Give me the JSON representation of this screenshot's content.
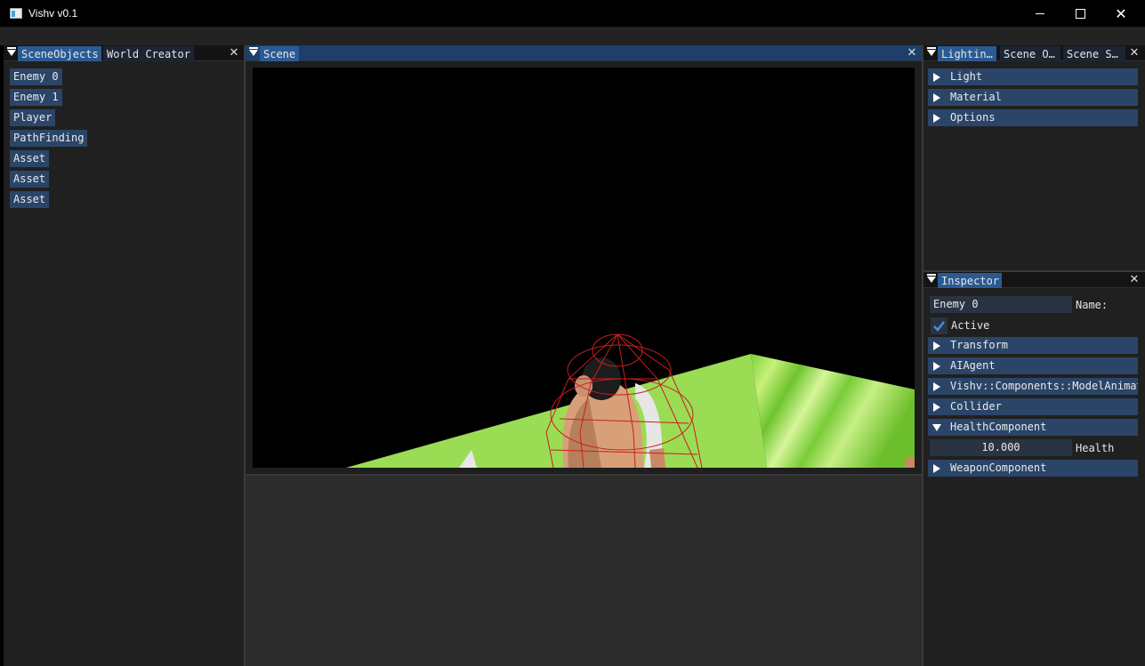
{
  "window": {
    "title": "Vishv v0.1",
    "minimize_icon": "minimize-icon",
    "maximize_icon": "maximize-icon",
    "close_glyph": "✕"
  },
  "left_panel": {
    "tabs": [
      "SceneObjects",
      "World Creator"
    ],
    "close_glyph": "✕",
    "objects": [
      "Enemy 0",
      "Enemy 1",
      "Player",
      "PathFinding",
      "Asset",
      "Asset",
      "Asset"
    ]
  },
  "scene_panel": {
    "tab": "Scene",
    "close_glyph": "✕"
  },
  "right_top_panel": {
    "tabs": [
      "Lightin…",
      "Scene O…",
      "Scene S…"
    ],
    "close_glyph": "✕",
    "sections": [
      "Light",
      "Material",
      "Options"
    ]
  },
  "inspector": {
    "tab": "Inspector",
    "close_glyph": "✕",
    "name_value": "Enemy 0",
    "name_label": "Name:",
    "active_label": "Active",
    "active_checked": true,
    "components": {
      "transform": "Transform",
      "ai_agent": "AIAgent",
      "model_animator": "Vishv::Components::ModelAnimat",
      "collider": "Collider",
      "health": "HealthComponent",
      "weapon": "WeaponComponent"
    },
    "health_value": "10.000",
    "health_label": "Health"
  },
  "colors": {
    "accent": "#2a5a93",
    "button": "#2a4568",
    "panel_bg": "#202020",
    "ground": "#8fd44a",
    "wireframe": "#c81e1e"
  }
}
